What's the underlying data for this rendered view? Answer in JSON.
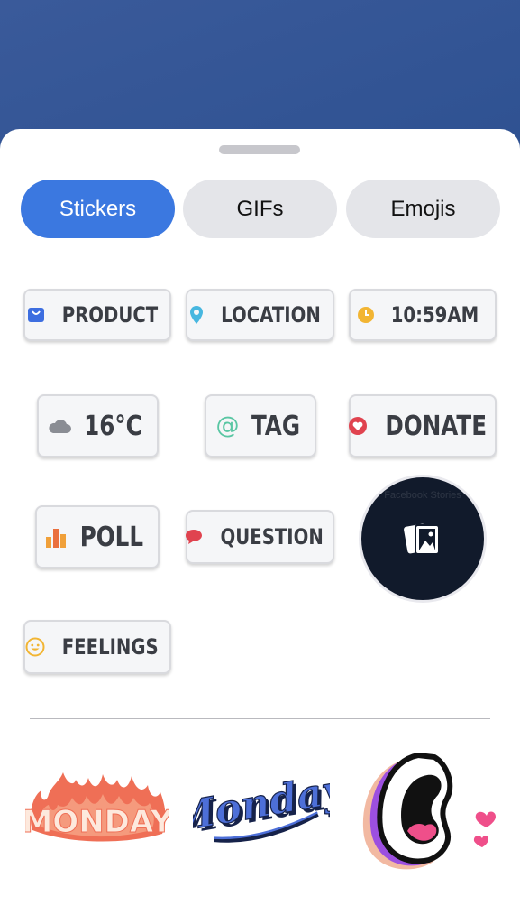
{
  "tabs": [
    {
      "label": "Stickers",
      "active": true
    },
    {
      "label": "GIFs",
      "active": false
    },
    {
      "label": "Emojis",
      "active": false
    }
  ],
  "stickers": {
    "product": {
      "label": "PRODUCT",
      "icon": "bag-icon"
    },
    "location": {
      "label": "LOCATION",
      "icon": "location-pin-icon"
    },
    "time": {
      "label": "10:59AM",
      "icon": "clock-icon"
    },
    "weather": {
      "label": "16°C",
      "icon": "cloud-icon"
    },
    "tag": {
      "label": "TAG",
      "icon": "at-icon"
    },
    "donate": {
      "label": "DONATE",
      "icon": "heart-donate-icon"
    },
    "poll": {
      "label": "POLL",
      "icon": "bar-chart-icon"
    },
    "question": {
      "label": "QUESTION",
      "icon": "speech-bubble-icon"
    },
    "feelings": {
      "label": "FEELINGS",
      "icon": "smiley-icon"
    },
    "photo": {
      "faint_text": "Facebook Stories",
      "icon": "photos-icon"
    }
  },
  "featured": [
    {
      "text": "MONDAY",
      "style": "flames"
    },
    {
      "text": "Monday",
      "style": "script"
    },
    {
      "text": "",
      "style": "shouting-mouth"
    }
  ],
  "colors": {
    "accent": "#3b78e0",
    "background": "#2b4f8f"
  }
}
